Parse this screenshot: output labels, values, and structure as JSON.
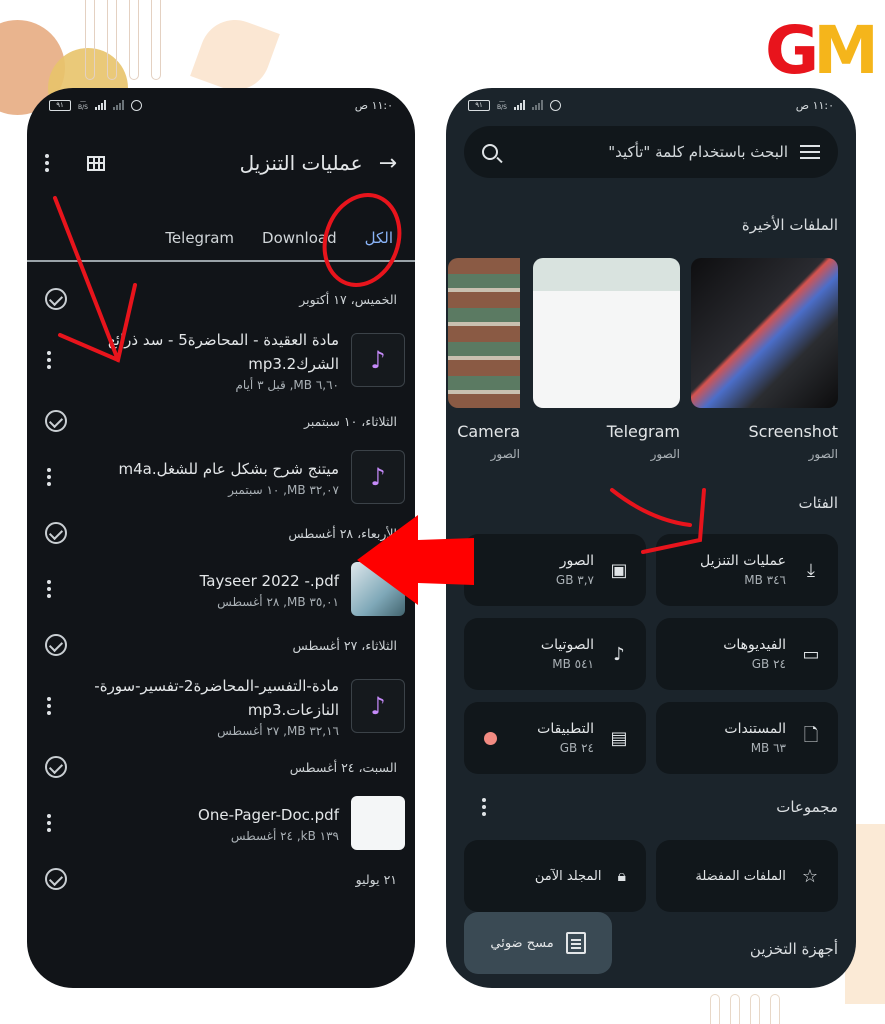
{
  "logo": {
    "g": "G",
    "m": "M"
  },
  "left_phone": {
    "status": {
      "time": "١١:٠ ص",
      "battery": "٩١",
      "network": "3G"
    },
    "header": {
      "title": "عمليات التنزيل",
      "back_icon": "arrow-back-icon",
      "grid_icon": "grid-view-icon",
      "menu_icon": "more-vert-icon"
    },
    "tabs": [
      {
        "label": "الكل",
        "active": true
      },
      {
        "label": "Download",
        "active": false
      },
      {
        "label": "Telegram",
        "active": false
      }
    ],
    "groups": [
      {
        "date": "الخميس، ١٧ أكتوبر",
        "files": [
          {
            "name": "مادة العقيدة - المحاضرة5 - سد ذرائع الشركmp3.2",
            "meta": "٦,٦٠ MB, قبل ٣ أيام",
            "type": "audio"
          }
        ]
      },
      {
        "date": "الثلاثاء، ١٠ سبتمبر",
        "files": [
          {
            "name": "ميتنج شرح بشكل عام للشغل.m4a",
            "meta": "٣٢,٠٧ MB, ١٠ سبتمبر",
            "type": "audio"
          }
        ]
      },
      {
        "date": "الأربعاء، ٢٨ أغسطس",
        "files": [
          {
            "name": "Tayseer 2022 -.pdf",
            "meta": "٣٥,٠١ MB, ٢٨ أغسطس",
            "type": "pdf-image"
          }
        ]
      },
      {
        "date": "الثلاثاء، ٢٧ أغسطس",
        "files": [
          {
            "name": "مادة-التفسير-المحاضرة2-تفسير-سورة-النازعات.mp3",
            "meta": "٣٢,١٦ MB, ٢٧ أغسطس",
            "type": "audio"
          }
        ]
      },
      {
        "date": "السبت، ٢٤ أغسطس",
        "files": [
          {
            "name": "One-Pager-Doc.pdf",
            "meta": "١٣٩ kB, ٢٤ أغسطس",
            "type": "pdf-doc"
          }
        ]
      },
      {
        "date": "٢١ يوليو",
        "files": []
      }
    ]
  },
  "right_phone": {
    "status": {
      "time": "١١:٠ ص",
      "battery": "٩١",
      "network": "3G"
    },
    "search": {
      "placeholder": "البحث باستخدام كلمة \"تأكيد\""
    },
    "recent": {
      "title": "الملفات الأخيرة",
      "items": [
        {
          "name": "Screenshot",
          "sub": "الصور"
        },
        {
          "name": "Telegram",
          "sub": "الصور"
        },
        {
          "name": "Camera",
          "sub": "الصور"
        }
      ]
    },
    "categories": {
      "title": "الفئات",
      "items": [
        {
          "label": "عمليات التنزيل",
          "size": "٣٤٦ MB",
          "icon": "download-icon"
        },
        {
          "label": "الصور",
          "size": "٣,٧ GB",
          "icon": "image-icon"
        },
        {
          "label": "الفيديوهات",
          "size": "٢٤ GB",
          "icon": "movie-icon"
        },
        {
          "label": "الصوتيات",
          "size": "٥٤١ MB",
          "icon": "music-note-icon"
        },
        {
          "label": "المستندات",
          "size": "٦٣ MB",
          "icon": "document-icon"
        },
        {
          "label": "التطبيقات",
          "size": "٢٤ GB",
          "icon": "android-icon"
        }
      ]
    },
    "collections": {
      "title": "مجموعات",
      "items": [
        {
          "label": "الملفات المفضلة",
          "icon": "star-icon"
        },
        {
          "label": "المجلد الآمن",
          "icon": "lock-icon"
        }
      ]
    },
    "storage": {
      "title": "أجهزة التخزين"
    },
    "scan_button": {
      "label": "مسح ضوئي"
    }
  },
  "colors": {
    "accent_tab": "#8ab4f8",
    "audio_icon": "#c58af9",
    "annotation_red": "#e8141c",
    "logo_red": "#e8141c",
    "logo_yellow": "#f5b51b",
    "apps_dot": "#f28b82"
  }
}
